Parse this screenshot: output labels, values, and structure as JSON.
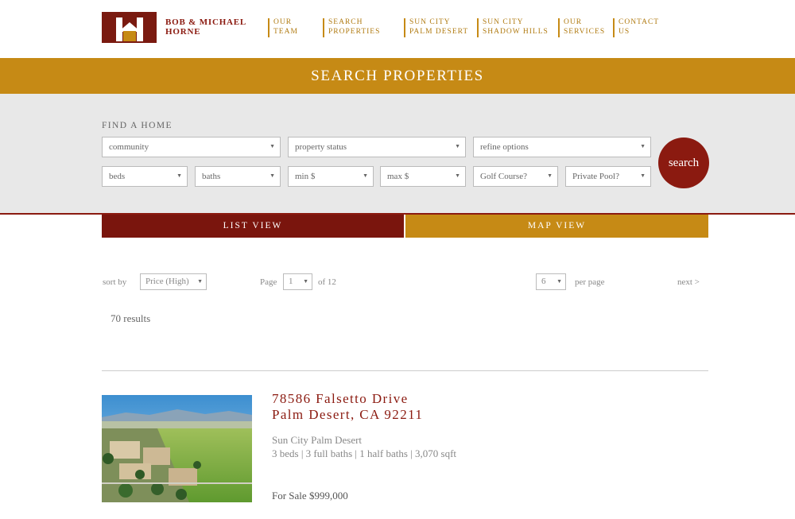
{
  "brand": {
    "name_line1": "BOB & MICHAEL",
    "name_line2": "HORNE"
  },
  "nav": [
    {
      "line1": "OUR",
      "line2": "TEAM"
    },
    {
      "line1": "SEARCH",
      "line2": "PROPERTIES"
    },
    {
      "line1": "SUN CITY",
      "line2": "PALM DESERT"
    },
    {
      "line1": "SUN CITY",
      "line2": "SHADOW HILLS"
    },
    {
      "line1": "OUR",
      "line2": "SERVICES"
    },
    {
      "line1": "CONTACT",
      "line2": "US"
    }
  ],
  "banner": {
    "title": "SEARCH PROPERTIES"
  },
  "search": {
    "label": "FIND A HOME",
    "community": "community",
    "property_status": "property status",
    "refine": "refine options",
    "beds": "beds",
    "baths": "baths",
    "min_price": "min $",
    "max_price": "max $",
    "golf": "Golf Course?",
    "pool": "Private Pool?",
    "button": "search"
  },
  "tabs": {
    "list": "LIST VIEW",
    "map": "MAP VIEW"
  },
  "controls": {
    "sort_label": "sort by",
    "sort_value": "Price (High)",
    "page_label": "Page",
    "page_value": "1",
    "page_of": "of 12",
    "per_page_value": "6",
    "per_page_label": "per page",
    "next": "next >",
    "results": "70 results"
  },
  "listing": {
    "address_line1": "78586 Falsetto Drive",
    "address_line2": "Palm Desert, CA 92211",
    "community": "Sun City Palm Desert",
    "details": "3 beds | 3 full baths | 1 half baths | 3,070 sqft",
    "price": "For Sale $999,000"
  },
  "colors": {
    "gold": "#c68a15",
    "maroon": "#8b1a10",
    "panel": "#e8e8e8"
  },
  "icons": {
    "dropdown": "chevron-down-icon",
    "logo": "house-icon"
  }
}
